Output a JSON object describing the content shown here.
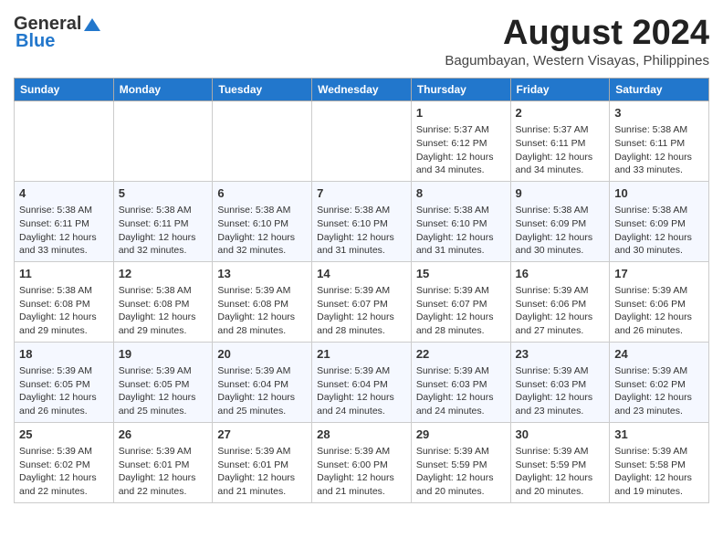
{
  "header": {
    "logo_general": "General",
    "logo_blue": "Blue",
    "title": "August 2024",
    "location": "Bagumbayan, Western Visayas, Philippines"
  },
  "days_of_week": [
    "Sunday",
    "Monday",
    "Tuesday",
    "Wednesday",
    "Thursday",
    "Friday",
    "Saturday"
  ],
  "weeks": [
    [
      {
        "day": "",
        "info": ""
      },
      {
        "day": "",
        "info": ""
      },
      {
        "day": "",
        "info": ""
      },
      {
        "day": "",
        "info": ""
      },
      {
        "day": "1",
        "info": "Sunrise: 5:37 AM\nSunset: 6:12 PM\nDaylight: 12 hours\nand 34 minutes."
      },
      {
        "day": "2",
        "info": "Sunrise: 5:37 AM\nSunset: 6:11 PM\nDaylight: 12 hours\nand 34 minutes."
      },
      {
        "day": "3",
        "info": "Sunrise: 5:38 AM\nSunset: 6:11 PM\nDaylight: 12 hours\nand 33 minutes."
      }
    ],
    [
      {
        "day": "4",
        "info": "Sunrise: 5:38 AM\nSunset: 6:11 PM\nDaylight: 12 hours\nand 33 minutes."
      },
      {
        "day": "5",
        "info": "Sunrise: 5:38 AM\nSunset: 6:11 PM\nDaylight: 12 hours\nand 32 minutes."
      },
      {
        "day": "6",
        "info": "Sunrise: 5:38 AM\nSunset: 6:10 PM\nDaylight: 12 hours\nand 32 minutes."
      },
      {
        "day": "7",
        "info": "Sunrise: 5:38 AM\nSunset: 6:10 PM\nDaylight: 12 hours\nand 31 minutes."
      },
      {
        "day": "8",
        "info": "Sunrise: 5:38 AM\nSunset: 6:10 PM\nDaylight: 12 hours\nand 31 minutes."
      },
      {
        "day": "9",
        "info": "Sunrise: 5:38 AM\nSunset: 6:09 PM\nDaylight: 12 hours\nand 30 minutes."
      },
      {
        "day": "10",
        "info": "Sunrise: 5:38 AM\nSunset: 6:09 PM\nDaylight: 12 hours\nand 30 minutes."
      }
    ],
    [
      {
        "day": "11",
        "info": "Sunrise: 5:38 AM\nSunset: 6:08 PM\nDaylight: 12 hours\nand 29 minutes."
      },
      {
        "day": "12",
        "info": "Sunrise: 5:38 AM\nSunset: 6:08 PM\nDaylight: 12 hours\nand 29 minutes."
      },
      {
        "day": "13",
        "info": "Sunrise: 5:39 AM\nSunset: 6:08 PM\nDaylight: 12 hours\nand 28 minutes."
      },
      {
        "day": "14",
        "info": "Sunrise: 5:39 AM\nSunset: 6:07 PM\nDaylight: 12 hours\nand 28 minutes."
      },
      {
        "day": "15",
        "info": "Sunrise: 5:39 AM\nSunset: 6:07 PM\nDaylight: 12 hours\nand 28 minutes."
      },
      {
        "day": "16",
        "info": "Sunrise: 5:39 AM\nSunset: 6:06 PM\nDaylight: 12 hours\nand 27 minutes."
      },
      {
        "day": "17",
        "info": "Sunrise: 5:39 AM\nSunset: 6:06 PM\nDaylight: 12 hours\nand 26 minutes."
      }
    ],
    [
      {
        "day": "18",
        "info": "Sunrise: 5:39 AM\nSunset: 6:05 PM\nDaylight: 12 hours\nand 26 minutes."
      },
      {
        "day": "19",
        "info": "Sunrise: 5:39 AM\nSunset: 6:05 PM\nDaylight: 12 hours\nand 25 minutes."
      },
      {
        "day": "20",
        "info": "Sunrise: 5:39 AM\nSunset: 6:04 PM\nDaylight: 12 hours\nand 25 minutes."
      },
      {
        "day": "21",
        "info": "Sunrise: 5:39 AM\nSunset: 6:04 PM\nDaylight: 12 hours\nand 24 minutes."
      },
      {
        "day": "22",
        "info": "Sunrise: 5:39 AM\nSunset: 6:03 PM\nDaylight: 12 hours\nand 24 minutes."
      },
      {
        "day": "23",
        "info": "Sunrise: 5:39 AM\nSunset: 6:03 PM\nDaylight: 12 hours\nand 23 minutes."
      },
      {
        "day": "24",
        "info": "Sunrise: 5:39 AM\nSunset: 6:02 PM\nDaylight: 12 hours\nand 23 minutes."
      }
    ],
    [
      {
        "day": "25",
        "info": "Sunrise: 5:39 AM\nSunset: 6:02 PM\nDaylight: 12 hours\nand 22 minutes."
      },
      {
        "day": "26",
        "info": "Sunrise: 5:39 AM\nSunset: 6:01 PM\nDaylight: 12 hours\nand 22 minutes."
      },
      {
        "day": "27",
        "info": "Sunrise: 5:39 AM\nSunset: 6:01 PM\nDaylight: 12 hours\nand 21 minutes."
      },
      {
        "day": "28",
        "info": "Sunrise: 5:39 AM\nSunset: 6:00 PM\nDaylight: 12 hours\nand 21 minutes."
      },
      {
        "day": "29",
        "info": "Sunrise: 5:39 AM\nSunset: 5:59 PM\nDaylight: 12 hours\nand 20 minutes."
      },
      {
        "day": "30",
        "info": "Sunrise: 5:39 AM\nSunset: 5:59 PM\nDaylight: 12 hours\nand 20 minutes."
      },
      {
        "day": "31",
        "info": "Sunrise: 5:39 AM\nSunset: 5:58 PM\nDaylight: 12 hours\nand 19 minutes."
      }
    ]
  ]
}
